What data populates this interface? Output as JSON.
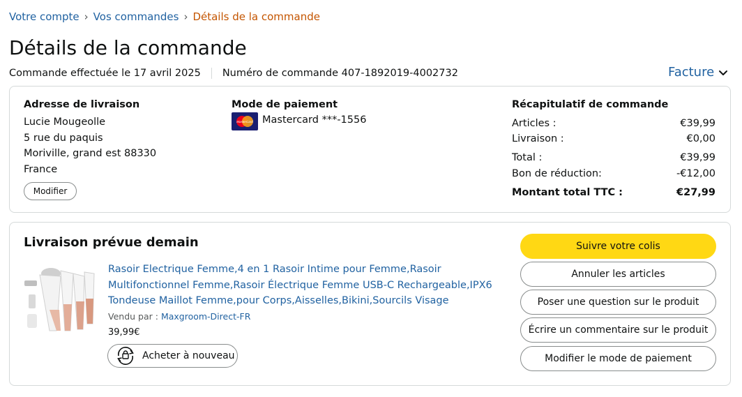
{
  "breadcrumb": {
    "account": "Votre compte",
    "sep1": "›",
    "orders": "Vos commandes",
    "sep2": "›",
    "current": "Détails de la commande"
  },
  "page": {
    "title": "Détails de la commande",
    "order_date": "Commande effectuée le 17 avril 2025",
    "order_number": "Numéro de commande 407-1892019-4002732",
    "invoice_label": "Facture"
  },
  "shipping": {
    "heading": "Adresse de livraison",
    "name": "Lucie Mougeolle",
    "street": "5 rue du paquis",
    "city": "Moriville, grand est 88330",
    "country": "France",
    "modify_label": "Modifier"
  },
  "payment": {
    "heading": "Mode de paiement",
    "card": "Mastercard ***-1556",
    "card_logo_text": "MasterCard"
  },
  "summary": {
    "heading": "Récapitulatif de commande",
    "rows": [
      {
        "label": "Articles :",
        "value": "€39,99"
      },
      {
        "label": "Livraison :",
        "value": "€0,00"
      },
      {
        "label": "Total :",
        "value": "€39,99"
      },
      {
        "label": "Bon de réduction:",
        "value": "-€12,00"
      }
    ],
    "grand_total_label": "Montant total TTC :",
    "grand_total_value": "€27,99"
  },
  "delivery": {
    "heading": "Livraison prévue demain",
    "product_lines": [
      "Rasoir Electrique Femme,4 en 1 Rasoir Intime pour Femme,Rasoir",
      "Multifonctionnel Femme,Rasoir Électrique Femme USB-C Rechargeable,IPX6",
      "Tondeuse Maillot Femme,pour Corps,Aisselles,Bikini,Sourcils Visage"
    ],
    "sold_by_label": "Vendu par  :",
    "seller": "Maxgroom-Direct-FR",
    "price": "39,99€",
    "buy_again_label": "Acheter à nouveau"
  },
  "actions": [
    {
      "label": "Suivre votre colis"
    },
    {
      "label": "Annuler les articles"
    },
    {
      "label": "Poser une question sur le produit"
    },
    {
      "label": "Écrire un commentaire sur le produit"
    },
    {
      "label": "Modifier le mode de paiement"
    }
  ],
  "colors": {
    "link": "#2162a1",
    "breadcrumb_current": "#c45500",
    "primary_button": "#ffd814",
    "border": "#d5d9d9",
    "text": "#0f1111"
  },
  "icons": {
    "invoice_chevron": "chevron-down-icon",
    "payment_card": "mastercard-icon",
    "buy_again": "buy-again-icon",
    "product": "product-thumbnail"
  }
}
